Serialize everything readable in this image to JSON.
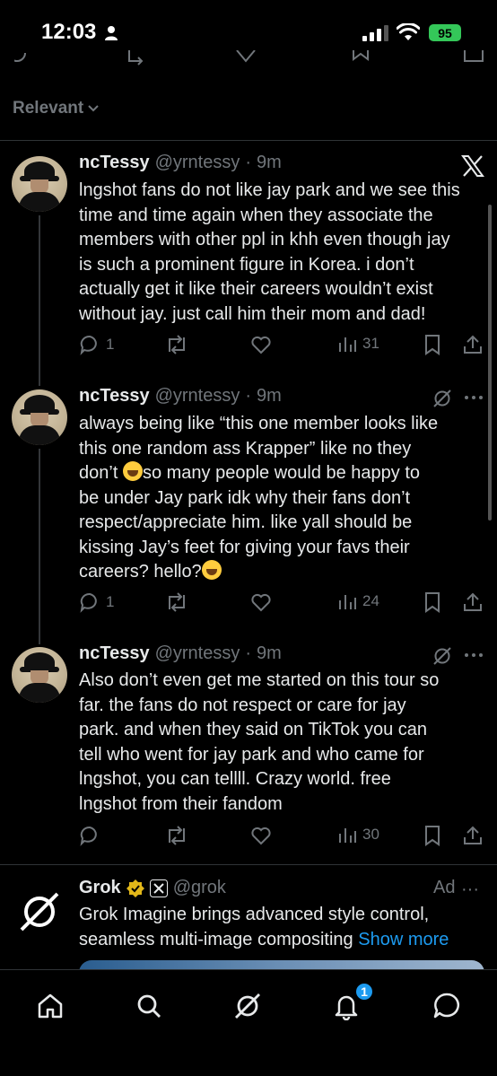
{
  "status_bar": {
    "time": "12:03",
    "battery": "95"
  },
  "sort": {
    "label": "Relevant"
  },
  "tweets": [
    {
      "name": "ncTessy",
      "handle": "@yrntessy",
      "dot": "·",
      "ago": "9m",
      "header_icon": "x-logo-icon",
      "lines": [
        "lngshot fans do not like jay park and we see this",
        "time and time again when they associate the",
        "members with other ppl in khh even though jay",
        "is such a prominent figure in Korea. i don’t",
        "actually get it like their careers wouldn’t exist",
        "without jay. just call him their mom and dad!"
      ],
      "replies": "1",
      "reposts": "",
      "likes": "",
      "views": "31"
    },
    {
      "name": "ncTessy",
      "handle": "@yrntessy",
      "dot": "·",
      "ago": "9m",
      "header_icon": "grok-icon",
      "lines": [
        "always being like “this one member looks like",
        "this one random ass Krapper” like no they",
        "don’t",
        "so many people would be happy to",
        "be under Jay park idk why their fans don’t",
        "respect/appreciate him. like yall should be",
        "kissing Jay’s feet for giving your favs their",
        "careers? hello?"
      ],
      "replies": "1",
      "reposts": "",
      "likes": "",
      "views": "24"
    },
    {
      "name": "ncTessy",
      "handle": "@yrntessy",
      "dot": "·",
      "ago": "9m",
      "header_icon": "grok-icon",
      "lines": [
        "Also don’t even get me started on this tour so",
        "far. the fans do not respect or care for jay",
        "park. and when they said on TikTok you can",
        "tell who went for jay park and who came for",
        "lngshot, you can tellll. Crazy world. free",
        "lngshot from their fandom"
      ],
      "replies": "",
      "reposts": "",
      "likes": "",
      "views": "30"
    }
  ],
  "ad": {
    "name": "Grok",
    "handle": "@grok",
    "label": "Ad",
    "more": "···",
    "line1": "Grok Imagine brings advanced style control,",
    "line2": "seamless multi-image compositing",
    "show_more": "Show more"
  },
  "tabbar": {
    "notifications_badge": "1"
  },
  "colors": {
    "background": "#000000",
    "text": "#e7e9ea",
    "muted": "#71767b",
    "accent": "#1d9bf0",
    "battery": "#34c759"
  }
}
